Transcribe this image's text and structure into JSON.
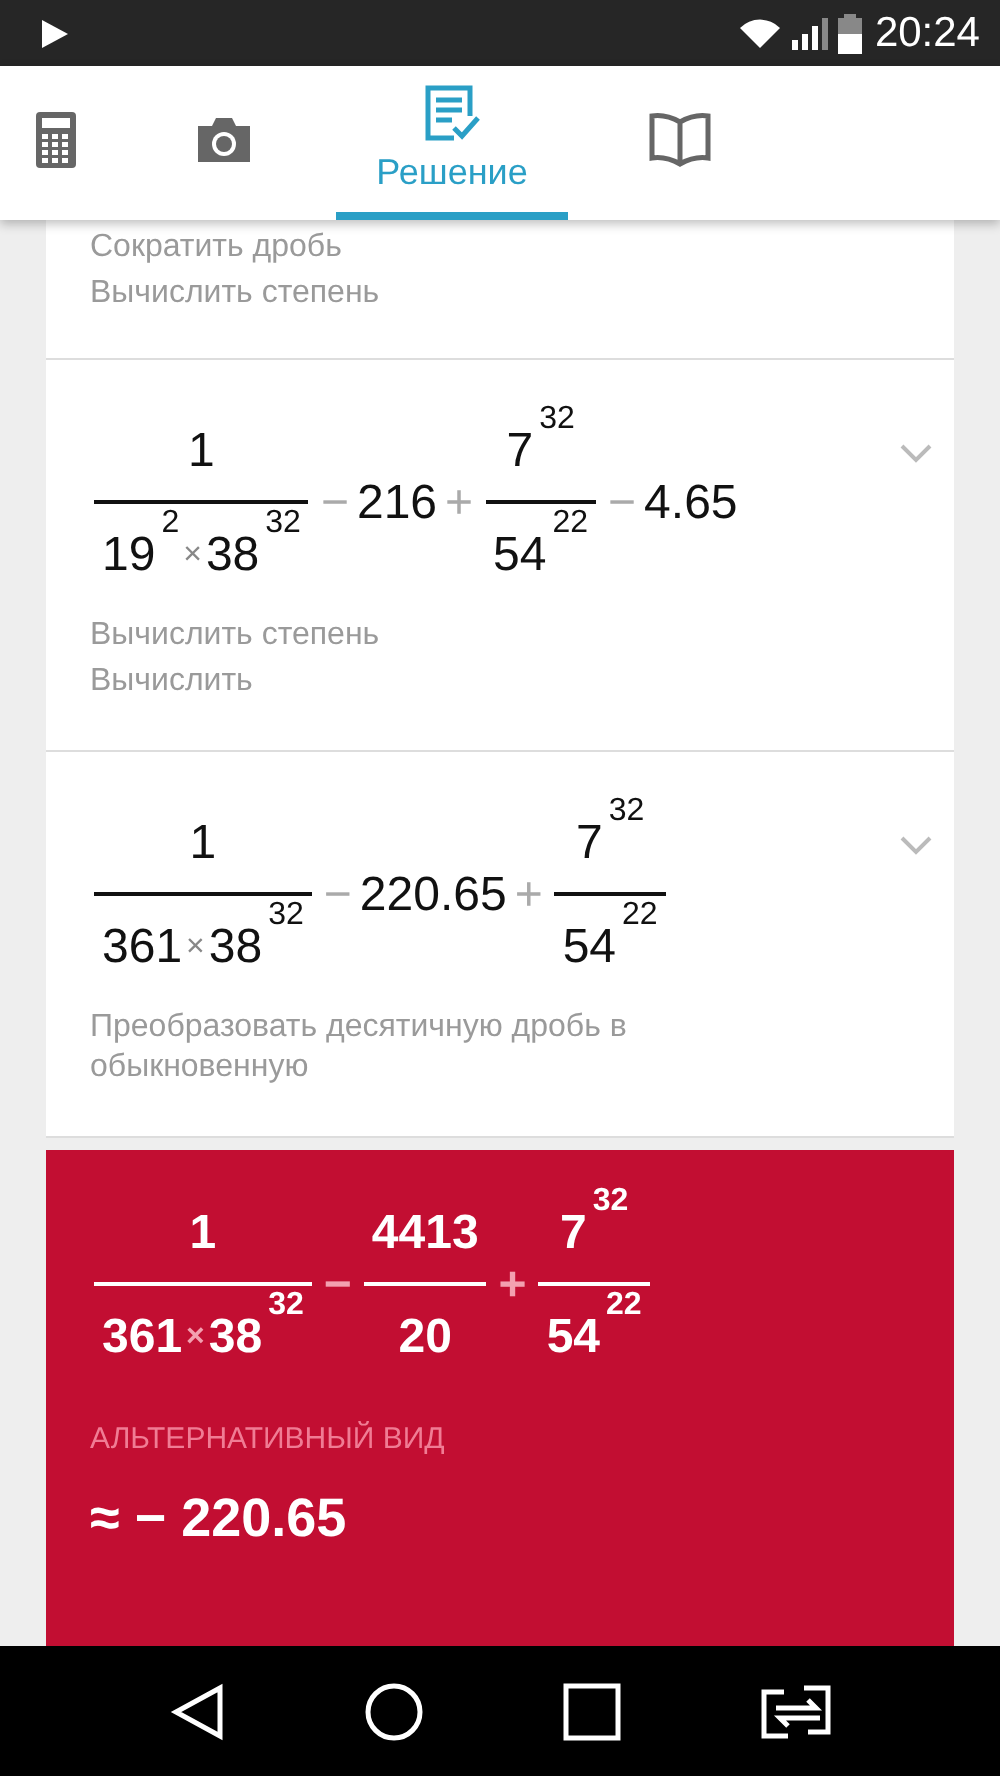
{
  "status_bar": {
    "time": "20:24"
  },
  "tabs": [
    {
      "kind": "calculator",
      "selected": false
    },
    {
      "kind": "camera",
      "selected": false
    },
    {
      "kind": "solution",
      "label": "Решение",
      "selected": true
    },
    {
      "kind": "book",
      "selected": false
    }
  ],
  "steps": [
    {
      "hints": [
        "Сократить дробь",
        "Вычислить степень"
      ]
    },
    {
      "expanded": false,
      "expression": [
        {
          "kind": "fraction",
          "numerator": [
            {
              "kind": "number",
              "text": "1"
            }
          ],
          "denominator": [
            {
              "kind": "number",
              "text": "19",
              "power": "2"
            },
            {
              "kind": "times",
              "text": "×"
            },
            {
              "kind": "number",
              "text": "38",
              "power": "32"
            }
          ]
        },
        {
          "kind": "operator",
          "text": "−"
        },
        {
          "kind": "number",
          "text": "216"
        },
        {
          "kind": "operator",
          "text": "+"
        },
        {
          "kind": "fraction",
          "numerator": [
            {
              "kind": "number",
              "text": "7",
              "power": "32"
            }
          ],
          "denominator": [
            {
              "kind": "number",
              "text": "54",
              "power": "22"
            }
          ]
        },
        {
          "kind": "operator",
          "text": "−"
        },
        {
          "kind": "number",
          "text": "4.65"
        }
      ],
      "hints": [
        "Вычислить степень",
        "Вычислить"
      ]
    },
    {
      "expanded": false,
      "expression": [
        {
          "kind": "fraction",
          "numerator": [
            {
              "kind": "number",
              "text": "1"
            }
          ],
          "denominator": [
            {
              "kind": "number",
              "text": "361"
            },
            {
              "kind": "times",
              "text": "×"
            },
            {
              "kind": "number",
              "text": "38",
              "power": "32"
            }
          ]
        },
        {
          "kind": "operator",
          "text": "−"
        },
        {
          "kind": "number",
          "text": "220.65"
        },
        {
          "kind": "operator",
          "text": "+"
        },
        {
          "kind": "fraction",
          "numerator": [
            {
              "kind": "number",
              "text": "7",
              "power": "32"
            }
          ],
          "denominator": [
            {
              "kind": "number",
              "text": "54",
              "power": "22"
            }
          ]
        }
      ],
      "hints": [
        "Преобразовать десятичную дробь в обыкновенную"
      ]
    }
  ],
  "result": {
    "expression": [
      {
        "kind": "fraction",
        "numerator": [
          {
            "kind": "number",
            "text": "1"
          }
        ],
        "denominator": [
          {
            "kind": "number",
            "text": "361"
          },
          {
            "kind": "times",
            "text": "×"
          },
          {
            "kind": "number",
            "text": "38",
            "power": "32"
          }
        ]
      },
      {
        "kind": "operator",
        "text": "−"
      },
      {
        "kind": "fraction",
        "numerator": [
          {
            "kind": "number",
            "text": "4413"
          }
        ],
        "denominator": [
          {
            "kind": "number",
            "text": "20"
          }
        ]
      },
      {
        "kind": "operator",
        "text": "+"
      },
      {
        "kind": "fraction",
        "numerator": [
          {
            "kind": "number",
            "text": "7",
            "power": "32"
          }
        ],
        "denominator": [
          {
            "kind": "number",
            "text": "54",
            "power": "22"
          }
        ]
      }
    ],
    "alternative_label": "АЛЬТЕРНАТИВНЫЙ ВИД",
    "approximation": "≈ − 220.65"
  }
}
